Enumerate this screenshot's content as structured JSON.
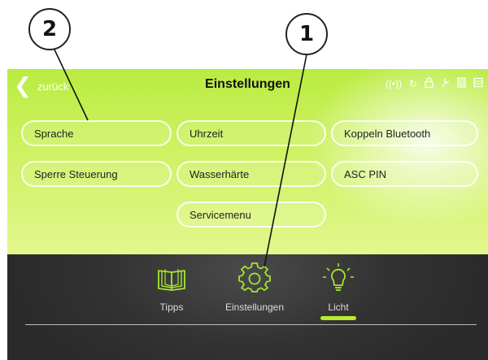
{
  "callouts": {
    "one": "1",
    "two": "2"
  },
  "header": {
    "back_label": "zurück",
    "title": "Einstellungen",
    "status_icons": [
      "wireless-icon",
      "sync-icon",
      "lock-icon",
      "wrench-icon",
      "device-icon",
      "battery-icon"
    ]
  },
  "menu": {
    "sprache": "Sprache",
    "uhrzeit": "Uhrzeit",
    "koppeln_bluetooth": "Koppeln Bluetooth",
    "sperre_steuerung": "Sperre Steuerung",
    "wasserhaerte": "Wasserhärte",
    "asc_pin": "ASC PIN",
    "servicemenu": "Servicemenu"
  },
  "bottom_nav": {
    "items": [
      {
        "label": "Tipps",
        "icon": "book-icon"
      },
      {
        "label": "Einstellungen",
        "icon": "gear-icon"
      },
      {
        "label": "Licht",
        "icon": "lightbulb-icon",
        "active": true
      }
    ],
    "accent_color": "#b7ec2e"
  },
  "colors": {
    "top_panel": "#c8ef55",
    "bottom_panel": "#333333",
    "icon_accent": "#a6e62a"
  }
}
